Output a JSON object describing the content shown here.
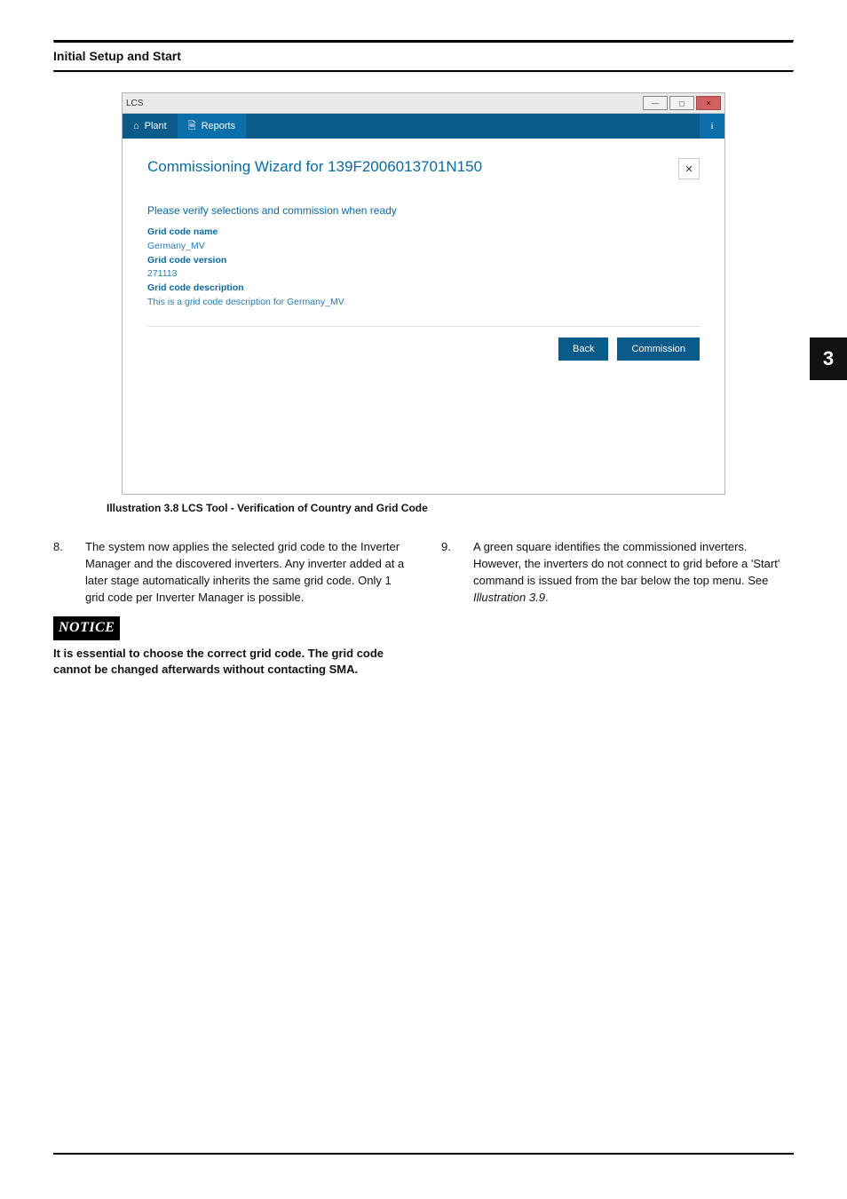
{
  "side_tab": "3",
  "header": {
    "section_title": "Initial Setup and Start"
  },
  "screenshot": {
    "window_title": "LCS",
    "appbar": {
      "plant_label": "Plant",
      "reports_label": "Reports",
      "info_label": "i"
    },
    "modal": {
      "title": "Commissioning Wizard for 139F2006013701N150",
      "close_glyph": "✕",
      "subheading": "Please verify selections and commission when ready",
      "fields": {
        "grid_code_name_label": "Grid code name",
        "grid_code_name_value": "Germany_MV",
        "grid_code_version_label": "Grid code version",
        "grid_code_version_value": "271113",
        "grid_code_description_label": "Grid code description",
        "grid_code_description_value": "This is a grid code description for Germany_MV"
      },
      "actions": {
        "back": "Back",
        "commission": "Commission"
      }
    }
  },
  "caption": "Illustration 3.8 LCS Tool - Verification of Country and Grid Code",
  "list": {
    "item8_num": "8.",
    "item8_text": "The system now applies the selected grid code to the Inverter Manager and the discovered inverters. Any inverter added at a later stage automatically inherits the same grid code. Only 1 grid code per Inverter Manager is possible.",
    "item9_num": "9.",
    "item9_text_pre": "A green square identifies the commissioned inverters. However, the inverters do not connect to grid before a 'Start' command is issued from the bar below the top menu. See ",
    "item9_text_ref": "Illustration 3.9",
    "item9_text_post": "."
  },
  "notice": {
    "badge": "NOTICE",
    "text": "It is essential to choose the correct grid code. The grid code cannot be changed afterwards without contacting SMA."
  }
}
